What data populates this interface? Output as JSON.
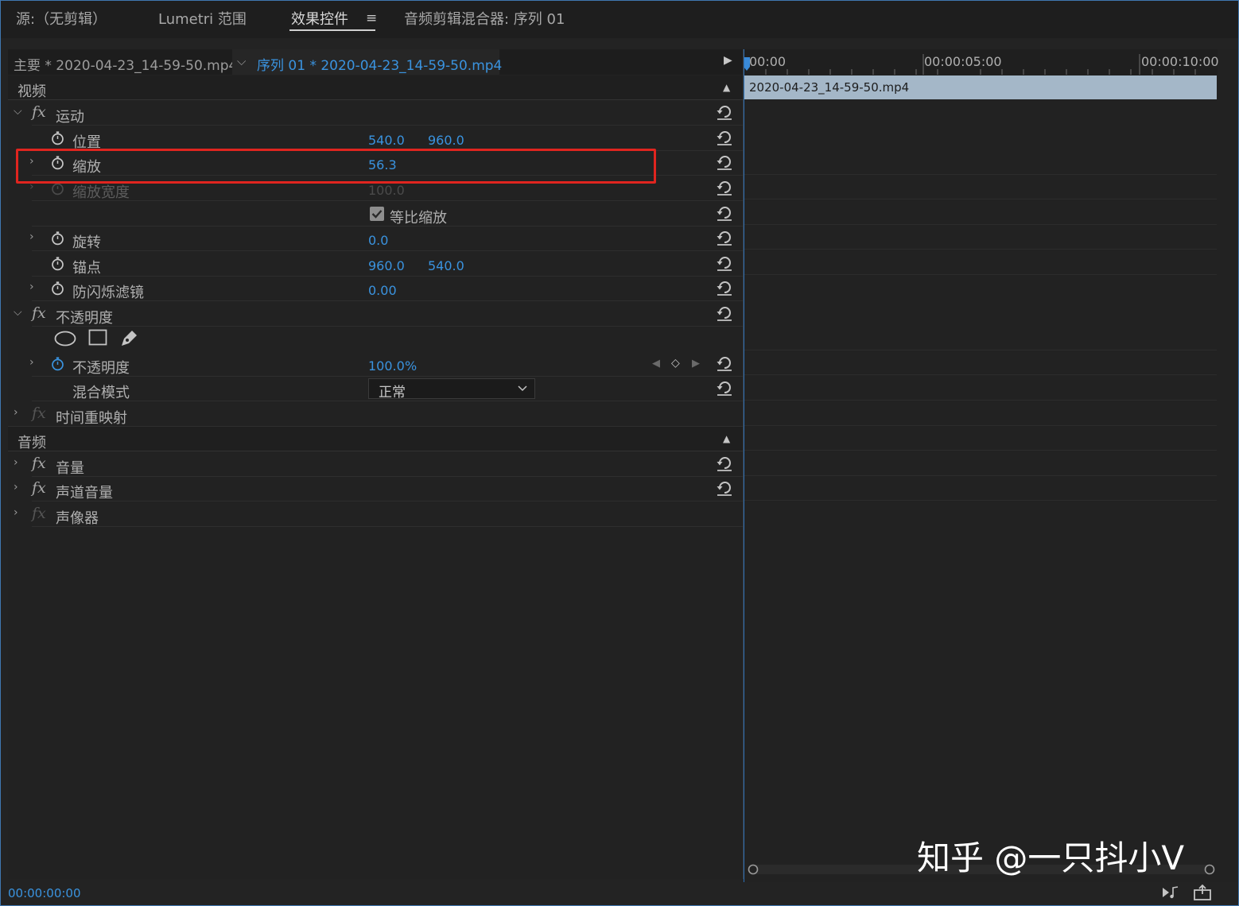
{
  "panel_tabs": {
    "source": "源:（无剪辑）",
    "lumetri": "Lumetri 范围",
    "effect_controls": "效果控件",
    "audio_mixer": "音频剪辑混合器: 序列 01"
  },
  "clip_bar": {
    "master": "主要 * 2020-04-23_14-59-50.mp4",
    "sequence": "序列 01 * 2020-04-23_14-59-50.mp4"
  },
  "video_section": "视频",
  "motion": {
    "label": "运动",
    "position": {
      "label": "位置",
      "x": "540.0",
      "y": "960.0"
    },
    "scale": {
      "label": "缩放",
      "value": "56.3"
    },
    "scale_width": {
      "label": "缩放宽度",
      "value": "100.0"
    },
    "uniform_scale": {
      "label": "等比缩放",
      "checked": true
    },
    "rotation": {
      "label": "旋转",
      "value": "0.0"
    },
    "anchor": {
      "label": "锚点",
      "x": "960.0",
      "y": "540.0"
    },
    "anti_flicker": {
      "label": "防闪烁滤镜",
      "value": "0.00"
    }
  },
  "opacity": {
    "label": "不透明度",
    "opacity": {
      "label": "不透明度",
      "value": "100.0",
      "unit": "%"
    },
    "blend_mode": {
      "label": "混合模式",
      "value": "正常"
    }
  },
  "time_remap": "时间重映射",
  "audio_section": "音频",
  "audio": {
    "volume": "音量",
    "channel_volume": "声道音量",
    "panner": "声像器"
  },
  "timecode": "00:00:00:00",
  "timeline": {
    "ticks": [
      "00:00",
      "00:00:05:00",
      "00:00:10:00"
    ],
    "clip_name": "2020-04-23_14-59-50.mp4"
  },
  "watermark": "知乎 @一只抖小V",
  "colors": {
    "accent_blue": "#3a93df",
    "highlight_red": "#e0251f",
    "clip_bar": "#a4b7c8"
  }
}
